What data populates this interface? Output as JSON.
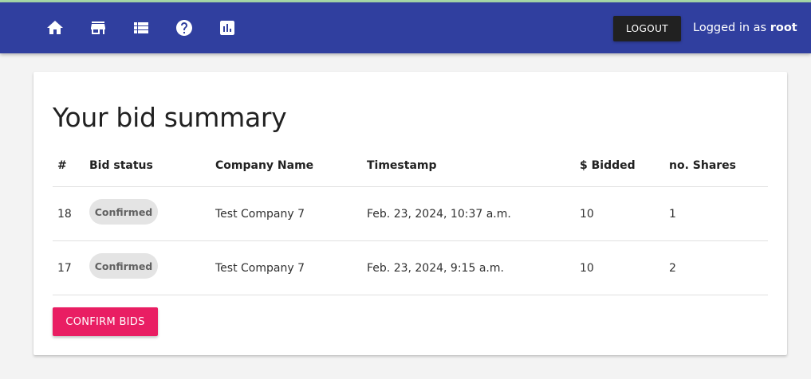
{
  "nav": {
    "icons": [
      "home-icon",
      "store-icon",
      "list-icon",
      "help-icon",
      "chart-icon"
    ],
    "logout_label": "LOGOUT",
    "logged_in_prefix": "Logged in as",
    "username": "root"
  },
  "colors": {
    "navbar": "#303f9f",
    "accent": "#e91e63",
    "logout": "#212121",
    "chip_bg": "#e4e4e4"
  },
  "summary": {
    "title": "Your bid summary",
    "columns": [
      "#",
      "Bid status",
      "Company Name",
      "Timestamp",
      "$ Bidded",
      "no. Shares"
    ],
    "rows": [
      {
        "id": "18",
        "status": "Confirmed",
        "company": "Test Company 7",
        "timestamp": "Feb. 23, 2024, 10:37 a.m.",
        "bidded": "10",
        "shares": "1"
      },
      {
        "id": "17",
        "status": "Confirmed",
        "company": "Test Company 7",
        "timestamp": "Feb. 23, 2024, 9:15 a.m.",
        "bidded": "10",
        "shares": "2"
      }
    ],
    "confirm_label": "CONFIRM BIDS"
  }
}
